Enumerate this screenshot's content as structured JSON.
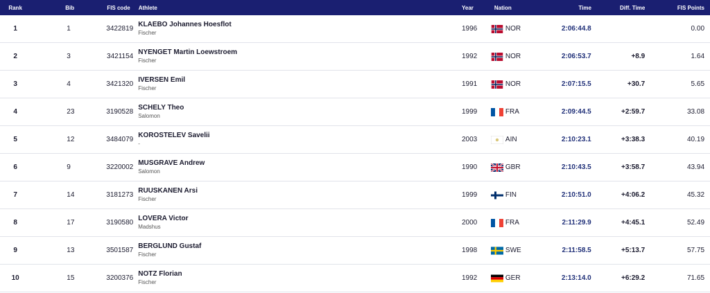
{
  "headers": {
    "rank": "Rank",
    "bib": "Bib",
    "fis_code": "FIS code",
    "athlete": "Athlete",
    "year": "Year",
    "nation": "Nation",
    "time": "Time",
    "diff_time": "Diff. Time",
    "fis_points": "FIS Points"
  },
  "rows": [
    {
      "rank": "1",
      "bib": "1",
      "fis_code": "3422819",
      "name": "KLAEBO Johannes Hoesflot",
      "brand": "Fischer",
      "year": "1996",
      "nation": "NOR",
      "flag": "nor-flag-icon",
      "time": "2:06:44.8",
      "diff": "",
      "points": "0.00"
    },
    {
      "rank": "2",
      "bib": "3",
      "fis_code": "3421154",
      "name": "NYENGET Martin Loewstroem",
      "brand": "Fischer",
      "year": "1992",
      "nation": "NOR",
      "flag": "nor-flag-icon",
      "time": "2:06:53.7",
      "diff": "+8.9",
      "points": "1.64"
    },
    {
      "rank": "3",
      "bib": "4",
      "fis_code": "3421320",
      "name": "IVERSEN Emil",
      "brand": "Fischer",
      "year": "1991",
      "nation": "NOR",
      "flag": "nor-flag-icon",
      "time": "2:07:15.5",
      "diff": "+30.7",
      "points": "5.65"
    },
    {
      "rank": "4",
      "bib": "23",
      "fis_code": "3190528",
      "name": "SCHELY Theo",
      "brand": "Salomon",
      "year": "1999",
      "nation": "FRA",
      "flag": "fra-flag-icon",
      "time": "2:09:44.5",
      "diff": "+2:59.7",
      "points": "33.08"
    },
    {
      "rank": "5",
      "bib": "12",
      "fis_code": "3484079",
      "name": "KOROSTELEV Savelii",
      "brand": "-",
      "year": "2003",
      "nation": "AIN",
      "flag": "ain-flag-icon",
      "time": "2:10:23.1",
      "diff": "+3:38.3",
      "points": "40.19"
    },
    {
      "rank": "6",
      "bib": "9",
      "fis_code": "3220002",
      "name": "MUSGRAVE Andrew",
      "brand": "Salomon",
      "year": "1990",
      "nation": "GBR",
      "flag": "gbr-flag-icon",
      "time": "2:10:43.5",
      "diff": "+3:58.7",
      "points": "43.94"
    },
    {
      "rank": "7",
      "bib": "14",
      "fis_code": "3181273",
      "name": "RUUSKANEN Arsi",
      "brand": "Fischer",
      "year": "1999",
      "nation": "FIN",
      "flag": "fin-flag-icon",
      "time": "2:10:51.0",
      "diff": "+4:06.2",
      "points": "45.32"
    },
    {
      "rank": "8",
      "bib": "17",
      "fis_code": "3190580",
      "name": "LOVERA Victor",
      "brand": "Madshus",
      "year": "2000",
      "nation": "FRA",
      "flag": "fra-flag-icon",
      "time": "2:11:29.9",
      "diff": "+4:45.1",
      "points": "52.49"
    },
    {
      "rank": "9",
      "bib": "13",
      "fis_code": "3501587",
      "name": "BERGLUND Gustaf",
      "brand": "Fischer",
      "year": "1998",
      "nation": "SWE",
      "flag": "swe-flag-icon",
      "time": "2:11:58.5",
      "diff": "+5:13.7",
      "points": "57.75"
    },
    {
      "rank": "10",
      "bib": "15",
      "fis_code": "3200376",
      "name": "NOTZ Florian",
      "brand": "Fischer",
      "year": "1992",
      "nation": "GER",
      "flag": "ger-flag-icon",
      "time": "2:13:14.0",
      "diff": "+6:29.2",
      "points": "71.65"
    }
  ],
  "colors": {
    "header_bg": "#1a1f71",
    "time_text": "#1f2f78",
    "row_border": "#e1e3ea"
  }
}
